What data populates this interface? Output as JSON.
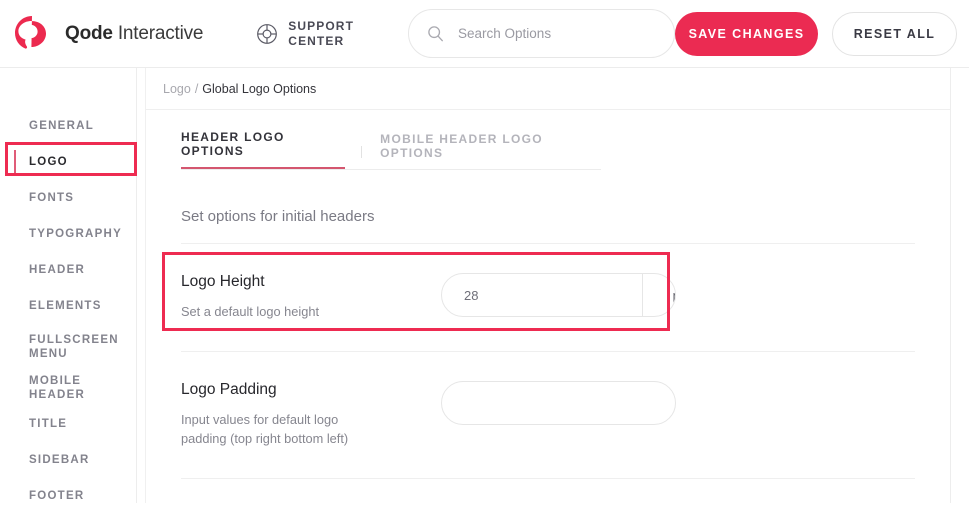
{
  "colors": {
    "accent": "#eb2b52",
    "annotation": "#ee2b51",
    "tab_underline": "#d4566f",
    "sidebar_active_bar": "#e05c78"
  },
  "topbar": {
    "brand_bold": "Qode",
    "brand_light": " Interactive",
    "brand_icon": "qode-logo-icon",
    "support": {
      "icon": "lifebuoy-icon",
      "label": "SUPPORT\nCENTER"
    },
    "search": {
      "icon": "search-icon",
      "placeholder": "Search Options",
      "value": ""
    },
    "save_label": "SAVE CHANGES",
    "reset_label": "RESET ALL"
  },
  "sidebar": {
    "items": [
      {
        "label": "GENERAL",
        "active": false
      },
      {
        "label": "LOGO",
        "active": true
      },
      {
        "label": "FONTS",
        "active": false
      },
      {
        "label": "TYPOGRAPHY",
        "active": false
      },
      {
        "label": "HEADER",
        "active": false
      },
      {
        "label": "ELEMENTS",
        "active": false
      },
      {
        "label": "FULLSCREEN\nMENU",
        "active": false
      },
      {
        "label": "MOBILE HEADER",
        "active": false
      },
      {
        "label": "TITLE",
        "active": false
      },
      {
        "label": "SIDEBAR",
        "active": false
      },
      {
        "label": "FOOTER",
        "active": false
      }
    ]
  },
  "breadcrumb": {
    "parent": "Logo",
    "separator": "/",
    "current": "Global Logo Options"
  },
  "main": {
    "tabs": [
      {
        "label": "HEADER LOGO OPTIONS",
        "active": true
      },
      {
        "label": "MOBILE HEADER LOGO OPTIONS",
        "active": false
      }
    ],
    "section_title": "Set options for initial headers",
    "fields": [
      {
        "title": "Logo Height",
        "description": "Set a default logo height",
        "value": "28",
        "unit": "px",
        "placeholder": ""
      },
      {
        "title": "Logo Padding",
        "description": "Input values for default logo padding (top right bottom left)",
        "value": "",
        "placeholder": ""
      }
    ]
  }
}
